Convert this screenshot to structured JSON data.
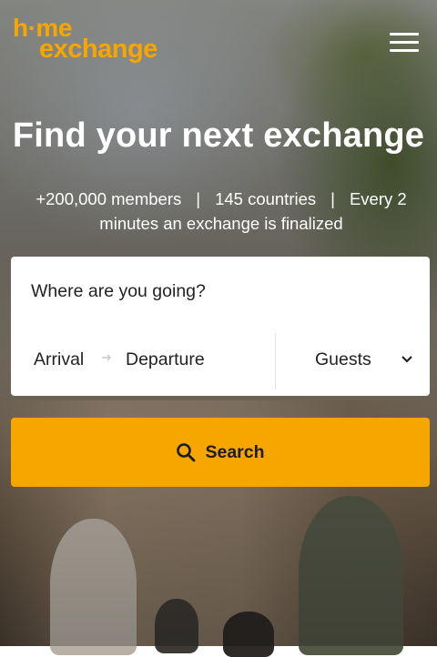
{
  "brand": {
    "logo_line1": "h·me",
    "logo_line2": "exchange",
    "color": "#f7a600"
  },
  "nav": {
    "menu_icon": "hamburger-menu-icon"
  },
  "hero": {
    "headline": "Find your next exchange",
    "stats": {
      "members": "+200,000 members",
      "separator": "|",
      "countries": "145 countries",
      "finalized": "Every 2 minutes an exchange is finalized"
    }
  },
  "search": {
    "destination_placeholder": "Where are you going?",
    "arrival_label": "Arrival",
    "departure_label": "Departure",
    "guests_label": "Guests",
    "button_label": "Search",
    "button_color": "#f7a600"
  }
}
